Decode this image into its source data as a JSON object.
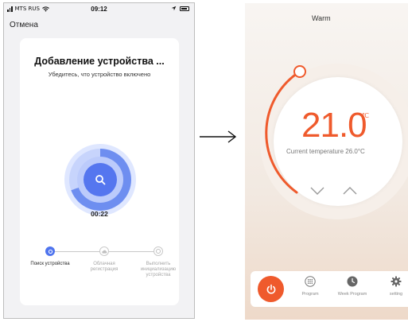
{
  "left": {
    "status": {
      "carrier": "MTS RUS",
      "time": "09:12"
    },
    "cancel_label": "Отмена",
    "title": "Добавление устройства ...",
    "subtitle": "Убедитесь, что устройство включено",
    "timer": "00:22",
    "steps": [
      {
        "label": "Поиск устройства",
        "state": "active"
      },
      {
        "label": "Облачная регистрация",
        "state": "inactive"
      },
      {
        "label": "Выполнить инициализацию устройства",
        "state": "inactive"
      }
    ],
    "colors": {
      "accent": "#5576ef"
    }
  },
  "right": {
    "mode_title": "Warm",
    "set_temp": "21.0",
    "unit": "℃",
    "current_label": "Current temperature 26.0°C",
    "toolbar": {
      "program": "Program",
      "week_program": "Week Program",
      "setting": "setting"
    },
    "colors": {
      "accent": "#ef5a2c"
    }
  }
}
